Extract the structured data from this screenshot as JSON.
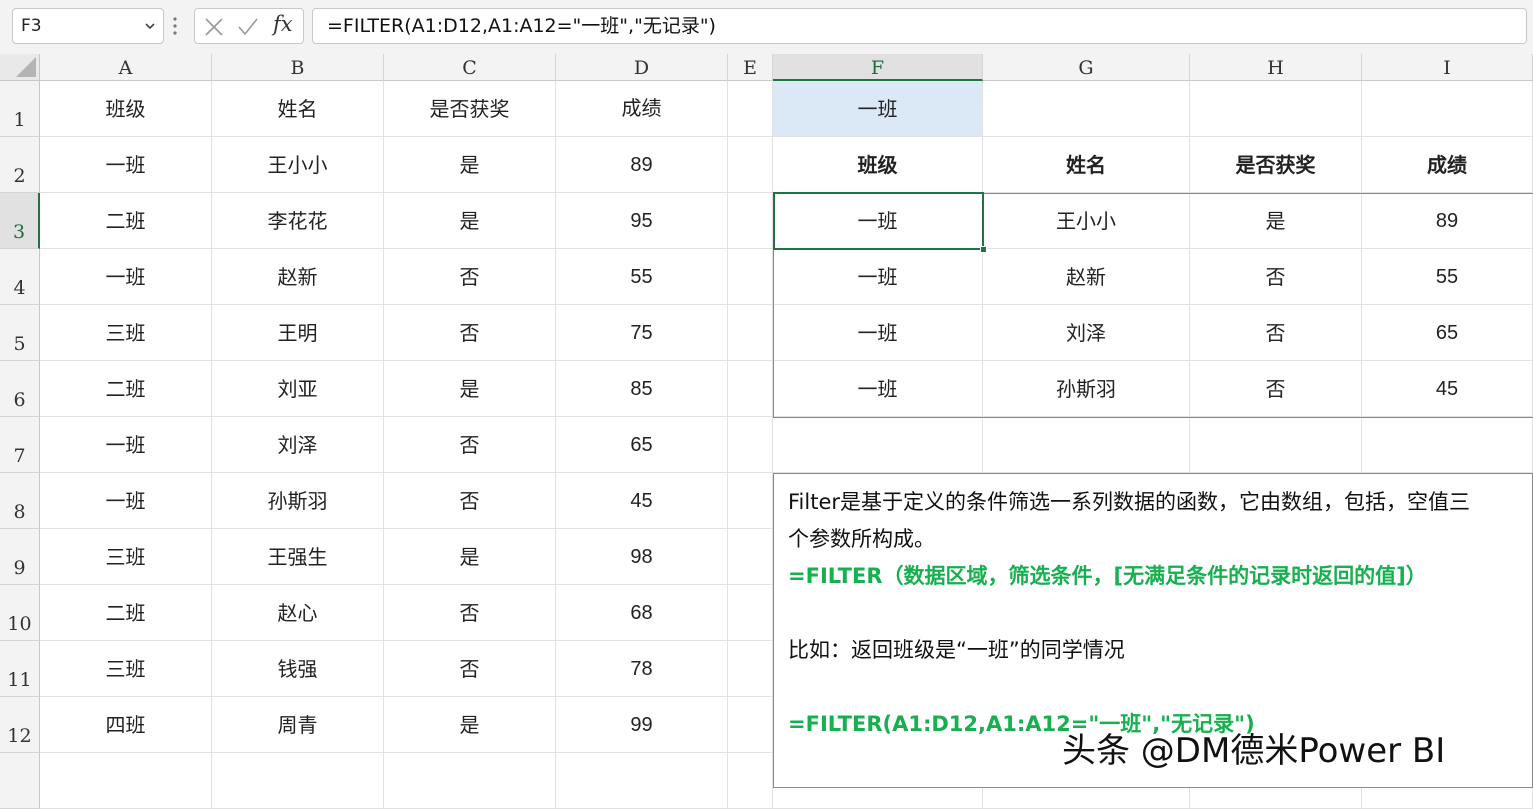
{
  "formula_bar": {
    "name_box": "F3",
    "fx_label": "fx",
    "formula": "=FILTER(A1:D12,A1:A12=\"一班\",\"无记录\")"
  },
  "columns": [
    "A",
    "B",
    "C",
    "D",
    "E",
    "F",
    "G",
    "H",
    "I"
  ],
  "selected_column": "F",
  "rows": [
    "1",
    "2",
    "3",
    "4",
    "5",
    "6",
    "7",
    "8",
    "9",
    "10",
    "11",
    "12"
  ],
  "selected_row": "3",
  "source_table": {
    "headers": [
      "班级",
      "姓名",
      "是否获奖",
      "成绩"
    ],
    "rows": [
      [
        "一班",
        "王小小",
        "是",
        "89"
      ],
      [
        "二班",
        "李花花",
        "是",
        "95"
      ],
      [
        "一班",
        "赵新",
        "否",
        "55"
      ],
      [
        "三班",
        "王明",
        "否",
        "75"
      ],
      [
        "二班",
        "刘亚",
        "是",
        "85"
      ],
      [
        "一班",
        "刘泽",
        "否",
        "65"
      ],
      [
        "一班",
        "孙斯羽",
        "否",
        "45"
      ],
      [
        "三班",
        "王强生",
        "是",
        "98"
      ],
      [
        "二班",
        "赵心",
        "否",
        "68"
      ],
      [
        "三班",
        "钱强",
        "否",
        "78"
      ],
      [
        "四班",
        "周青",
        "是",
        "99"
      ]
    ]
  },
  "filter_result": {
    "criteria_cell": "一班",
    "headers": [
      "班级",
      "姓名",
      "是否获奖",
      "成绩"
    ],
    "rows": [
      [
        "一班",
        "王小小",
        "是",
        "89"
      ],
      [
        "一班",
        "赵新",
        "否",
        "55"
      ],
      [
        "一班",
        "刘泽",
        "否",
        "65"
      ],
      [
        "一班",
        "孙斯羽",
        "否",
        "45"
      ]
    ]
  },
  "note": {
    "line1": "Filter是基于定义的条件筛选一系列数据的函数，它由数组，包括，空值三",
    "line2": "个参数所构成。",
    "syntax": "=FILTER（数据区域，筛选条件，[无满足条件的记录时返回的值]）",
    "example_intro": "比如：返回班级是“一班”的同学情况",
    "example_formula": "=FILTER(A1:D12,A1:A12=\"一班\",\"无记录\")"
  },
  "watermark": "头条 @DM德米Power BI",
  "colors": {
    "accent_green": "#217346",
    "note_green": "#16b04f",
    "criteria_fill": "#dbe8f5",
    "spill_border": "#5d8ec5"
  }
}
